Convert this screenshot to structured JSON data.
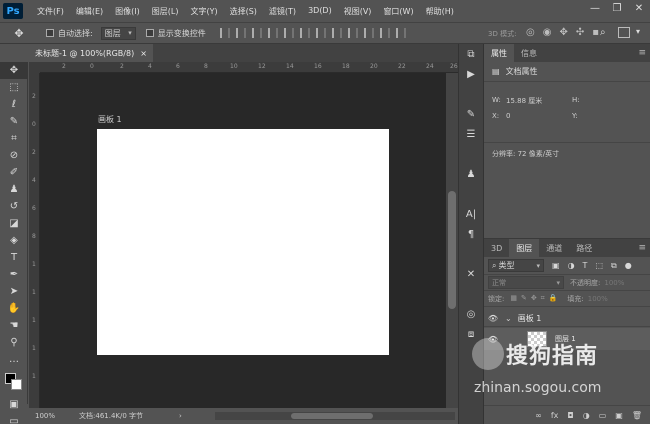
{
  "app": {
    "logo": "Ps",
    "menu": [
      "文件(F)",
      "编辑(E)",
      "图像(I)",
      "图层(L)",
      "文字(Y)",
      "选择(S)",
      "滤镜(T)",
      "3D(D)",
      "视图(V)",
      "窗口(W)",
      "帮助(H)"
    ],
    "window_controls": [
      "—",
      "❐",
      "✕"
    ]
  },
  "options": {
    "auto_select_label": "自动选择:",
    "auto_select_value": "图层",
    "show_transform_label": "显示变换控件",
    "mode_3d_label": "3D 模式:"
  },
  "document": {
    "tab_title": "未标题-1 @ 100%(RGB/8)",
    "tab_close": "×",
    "artboard_name": "画板 1",
    "ruler_h_labels": [
      "2",
      "0",
      "2",
      "4",
      "6",
      "8",
      "10",
      "12",
      "14",
      "16",
      "18",
      "20",
      "22",
      "24",
      "26"
    ],
    "ruler_v_labels": [
      "2",
      "0",
      "2",
      "4",
      "6",
      "8",
      "1",
      "1",
      "1",
      "1",
      "1"
    ]
  },
  "status": {
    "zoom": "100%",
    "doc_info": "文档:461.4K/0 字节",
    "arrow": "›"
  },
  "properties": {
    "tabs": [
      "属性",
      "信息"
    ],
    "section_title": "文档属性",
    "w_label": "W:",
    "w_value": "15.88 厘米",
    "h_label": "H:",
    "x_label": "X:",
    "x_value": "0",
    "y_label": "Y:",
    "resolution": "分辨率: 72 像素/英寸"
  },
  "layers": {
    "tabs": [
      "3D",
      "图层",
      "通道",
      "路径"
    ],
    "filter_kind": "类型",
    "blend_mode": "正常",
    "opacity_label": "不透明度:",
    "opacity_value": "100%",
    "lock_label": "锁定:",
    "fill_label": "填充:",
    "fill_value": "100%",
    "artboard_layer": "画板 1",
    "layer_name": "图层 1",
    "bottom_icons": [
      "∞",
      "fx",
      "◘",
      "◑",
      "▭",
      "▣",
      "🗑"
    ]
  },
  "watermark": {
    "title": "搜狗指南",
    "url": "zhinan.sogou.com"
  },
  "icons": {
    "tools": [
      "move-icon",
      "marquee-icon",
      "lasso-icon",
      "quick-select-icon",
      "crop-icon",
      "eyedropper-icon",
      "healing-icon",
      "brush-icon",
      "stamp-icon",
      "history-brush-icon",
      "eraser-icon",
      "gradient-icon",
      "dodge-icon",
      "pen-icon",
      "type-icon",
      "path-select-icon",
      "shape-icon",
      "hand-icon",
      "zoom-icon",
      "more-icon"
    ]
  }
}
